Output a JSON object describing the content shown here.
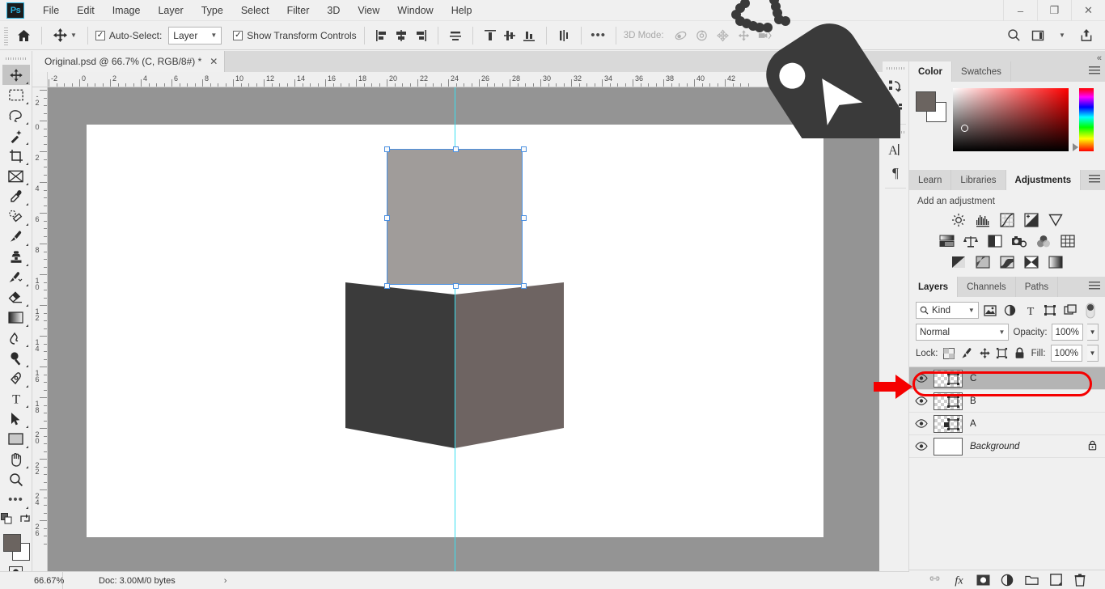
{
  "app": {
    "logo_text": "Ps",
    "menus": [
      "File",
      "Edit",
      "Image",
      "Layer",
      "Type",
      "Select",
      "Filter",
      "3D",
      "View",
      "Window",
      "Help"
    ],
    "window_controls": [
      {
        "name": "minimize",
        "glyph": "–"
      },
      {
        "name": "maximize",
        "glyph": "❐"
      },
      {
        "name": "close",
        "glyph": "✕"
      }
    ]
  },
  "options_bar": {
    "home_icon": "home-icon",
    "tool_icon": "move-tool-icon",
    "auto_select_checked": true,
    "auto_select_label": "Auto-Select:",
    "auto_select_value": "Layer",
    "show_transform_checked": true,
    "show_transform_label": "Show Transform Controls",
    "align_group_1": [
      "align-left-edges-icon",
      "align-horizontal-centers-icon",
      "align-right-edges-icon"
    ],
    "align_group_2": [
      "distribute-horizontal-icon"
    ],
    "align_group_3": [
      "align-top-edges-icon",
      "align-vertical-centers-icon",
      "align-bottom-edges-icon"
    ],
    "align_group_4": [
      "distribute-vertical-icon"
    ],
    "more_label": "•••",
    "mode_3d_label": "3D Mode:",
    "mode_3d_icons": [
      "orbit-3d-icon",
      "roll-3d-icon",
      "pan-3d-icon",
      "slide-3d-icon",
      "camera-3d-icon"
    ],
    "right_icons": [
      "search-icon",
      "workspace-icon",
      "chevron-down-icon",
      "share-icon"
    ]
  },
  "document": {
    "tab_title": "Original.psd @ 66.7% (C, RGB/8#) *",
    "close_glyph": "✕"
  },
  "toolbar": {
    "tools": [
      {
        "name": "move-tool",
        "selected": true
      },
      {
        "name": "rectangular-marquee-tool",
        "selected": false
      },
      {
        "name": "lasso-tool",
        "selected": false
      },
      {
        "name": "magic-wand-tool",
        "selected": false
      },
      {
        "name": "crop-tool",
        "selected": false
      },
      {
        "name": "frame-tool",
        "selected": false
      },
      {
        "name": "eyedropper-tool",
        "selected": false
      },
      {
        "name": "spot-healing-brush-tool",
        "selected": false
      },
      {
        "name": "brush-tool",
        "selected": false
      },
      {
        "name": "clone-stamp-tool",
        "selected": false
      },
      {
        "name": "history-brush-tool",
        "selected": false
      },
      {
        "name": "eraser-tool",
        "selected": false
      },
      {
        "name": "gradient-tool",
        "selected": false
      },
      {
        "name": "smudge-tool",
        "selected": false
      },
      {
        "name": "dodge-tool",
        "selected": false
      },
      {
        "name": "pen-tool",
        "selected": false
      },
      {
        "name": "type-tool",
        "selected": false
      },
      {
        "name": "path-selection-tool",
        "selected": false
      },
      {
        "name": "rectangle-tool",
        "selected": false
      },
      {
        "name": "hand-tool",
        "selected": false
      },
      {
        "name": "zoom-tool",
        "selected": false
      },
      {
        "name": "edit-toolbar-tool",
        "selected": false
      }
    ],
    "foreground_color": "#6b6460",
    "background_color": "#ffffff",
    "quick_mask_icon": "quick-mask-icon",
    "screen_mode_icon": "screen-mode-icon"
  },
  "rulers": {
    "unit_step": 2,
    "h_labels": [
      "-2",
      "0",
      "2",
      "4",
      "6",
      "8",
      "10",
      "12",
      "14",
      "16",
      "18",
      "20",
      "22",
      "24",
      "26",
      "28",
      "30",
      "32",
      "34",
      "36",
      "38",
      "40",
      "42"
    ],
    "v_labels": [
      "-2",
      "0",
      "2",
      "4",
      "6",
      "8",
      "10",
      "12",
      "14",
      "16",
      "18",
      "20",
      "22",
      "24",
      "26"
    ]
  },
  "canvas": {
    "background_color": "#949494",
    "artboard_color": "#ffffff",
    "guide_color": "#3ae0f0",
    "selection_border_color": "#4a90e2",
    "selected_shape_color": "#a09c9a",
    "left_panel_color": "#3b3b3b",
    "right_panel_color": "#6e6462"
  },
  "icon_rail": {
    "items": [
      "history-icon",
      "3d-icon",
      "character-icon",
      "paragraph-icon"
    ],
    "collapse_icon": "collapse-panels-icon"
  },
  "color_panel": {
    "tabs": [
      {
        "label": "Color",
        "active": true
      },
      {
        "label": "Swatches",
        "active": false
      }
    ],
    "foreground_color": "#6b6460",
    "background_color": "#ffffff",
    "menu_icon": "panel-menu-icon"
  },
  "adjustments_panel": {
    "tabs": [
      {
        "label": "Learn",
        "active": false
      },
      {
        "label": "Libraries",
        "active": false
      },
      {
        "label": "Adjustments",
        "active": true
      }
    ],
    "heading": "Add an adjustment",
    "rows": [
      [
        "brightness-contrast-icon",
        "levels-icon",
        "curves-icon",
        "exposure-icon",
        "vibrance-icon"
      ],
      [
        "hue-saturation-icon",
        "color-balance-icon",
        "black-white-icon",
        "photo-filter-icon",
        "channel-mixer-icon",
        "color-lookup-icon"
      ],
      [
        "invert-icon",
        "posterize-icon",
        "threshold-icon",
        "gradient-map-icon",
        "selective-color-icon"
      ]
    ],
    "menu_icon": "panel-menu-icon"
  },
  "layers_panel": {
    "tabs": [
      {
        "label": "Layers",
        "active": true
      },
      {
        "label": "Channels",
        "active": false
      },
      {
        "label": "Paths",
        "active": false
      }
    ],
    "menu_icon": "panel-menu-icon",
    "filter_label": "Kind",
    "filter_icons": [
      "filter-pixel-icon",
      "filter-adjustment-icon",
      "filter-type-icon",
      "filter-shape-icon",
      "filter-smart-icon"
    ],
    "filter_toggle": "filter-enable-toggle",
    "blend_mode": "Normal",
    "opacity_label": "Opacity:",
    "opacity_value": "100%",
    "lock_label": "Lock:",
    "lock_icons": [
      "lock-transparency-icon",
      "lock-image-icon",
      "lock-position-icon",
      "lock-artboard-icon",
      "lock-all-icon"
    ],
    "fill_label": "Fill:",
    "fill_value": "100%",
    "layers": [
      {
        "name": "C",
        "visible": true,
        "selected": true,
        "locked": false,
        "thumb": "alpha"
      },
      {
        "name": "B",
        "visible": true,
        "selected": false,
        "locked": false,
        "thumb": "alpha"
      },
      {
        "name": "A",
        "visible": true,
        "selected": false,
        "locked": false,
        "thumb": "alpha"
      },
      {
        "name": "Background",
        "visible": true,
        "selected": false,
        "locked": true,
        "thumb": "white"
      }
    ],
    "footer_icons": [
      "link-layers-icon",
      "layer-styles-icon",
      "layer-mask-icon",
      "adjustment-layer-icon",
      "new-group-icon",
      "new-layer-icon",
      "delete-layer-icon"
    ]
  },
  "status_bar": {
    "zoom": "66.67%",
    "doc_info": "Doc: 3.00M/0 bytes",
    "expand_glyph": "›"
  },
  "annotations": {
    "arrow_color": "#f50000",
    "highlight_color": "#f50000",
    "arrow_name": "red-pointer-arrow",
    "highlight_name": "red-highlight-ellipse",
    "cursor_overlay_name": "cursor-tag-overlay",
    "cursor_overlay_color": "#3a3a3a"
  },
  "colors": {
    "accent": "#2bb3e0",
    "panel_bg": "#f0f0f0",
    "panel_tab_bg": "#d9d9d9",
    "canvas_bg": "#949494"
  }
}
